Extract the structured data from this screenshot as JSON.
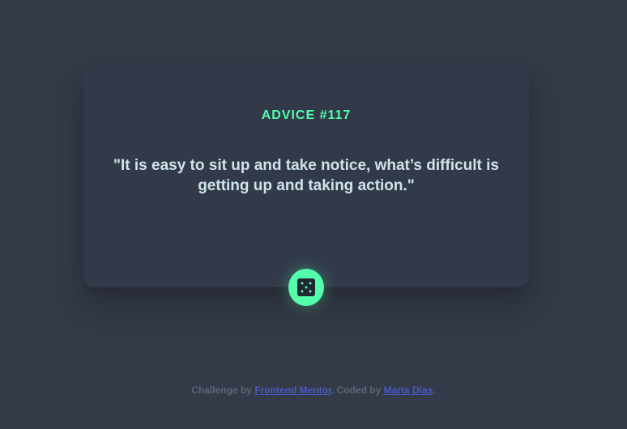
{
  "card": {
    "advice_id": "ADVICE #117",
    "advice_text": "\"It is easy to sit up and take notice, what’s difficult is getting up and taking action.\""
  },
  "dice_button": {
    "icon": "dice-icon",
    "color": "#53ffaa"
  },
  "footer": {
    "prefix": "Challenge by",
    "link1": "Frontend Mentor",
    "middle": ". Coded by",
    "link2": "Marta Dias",
    "suffix": "."
  },
  "colors": {
    "background": "#333a48",
    "card": "#323a49",
    "accent": "#53ffaa",
    "text": "#cee3e9",
    "footer_text": "#5e6676",
    "link": "#4c59c3"
  }
}
